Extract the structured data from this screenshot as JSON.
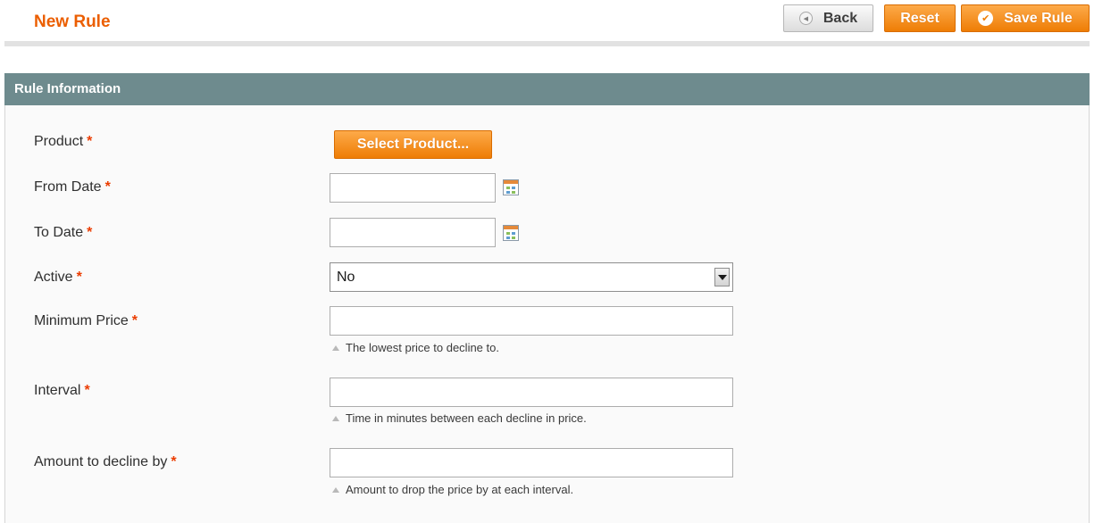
{
  "header": {
    "title": "New Rule",
    "buttons": {
      "back_label": "Back",
      "reset_label": "Reset",
      "save_label": "Save Rule"
    }
  },
  "fieldset": {
    "title": "Rule Information",
    "required_marker": "*",
    "fields": {
      "product": {
        "label": "Product",
        "button_label": "Select Product..."
      },
      "from_date": {
        "label": "From Date",
        "value": ""
      },
      "to_date": {
        "label": "To Date",
        "value": ""
      },
      "active": {
        "label": "Active",
        "selected": "No"
      },
      "minimum_price": {
        "label": "Minimum Price",
        "value": "",
        "note": "The lowest price to decline to."
      },
      "interval": {
        "label": "Interval",
        "value": "",
        "note": "Time in minutes between each decline in price."
      },
      "amount": {
        "label": "Amount to decline by",
        "value": "",
        "note": "Amount to drop the price by at each interval."
      }
    }
  },
  "colors": {
    "accent": "#eb5e00",
    "button_orange": "#ee7d05",
    "section_header": "#6e8b8e"
  },
  "icons": [
    "back-circle-icon",
    "checkmark-icon",
    "calendar-icon",
    "dropdown-arrow-icon",
    "note-triangle-icon"
  ]
}
